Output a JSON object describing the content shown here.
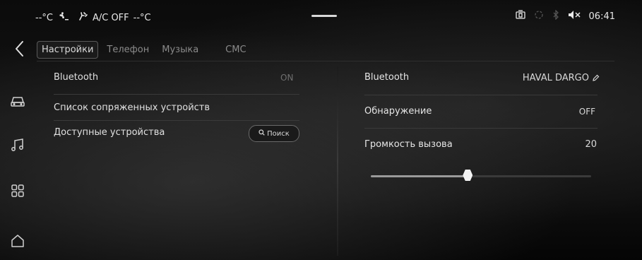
{
  "status_bar": {
    "temp_left": "--°C",
    "fan_icon": "fan-icon",
    "seat_icon": "seat-heat-icon",
    "ac_label": "A/C OFF",
    "temp_right": "--°C",
    "time": "06:41",
    "icons": [
      "phone-projection-icon",
      "sync-icon",
      "bluetooth-icon",
      "mute-icon"
    ]
  },
  "tabs": [
    {
      "label": "Настройки",
      "active": true
    },
    {
      "label": "Телефон",
      "active": false
    },
    {
      "label": "Музыка",
      "active": false
    },
    {
      "label": "СМС",
      "active": false
    }
  ],
  "side_nav": [
    "car-icon",
    "music-icon",
    "apps-icon",
    "home-icon"
  ],
  "left_panel": {
    "bluetooth_label": "Bluetooth",
    "bluetooth_value": "ON",
    "paired_label": "Список сопряженных устройств",
    "available_label": "Доступные устройства",
    "search_label": "Поиск"
  },
  "right_panel": {
    "bluetooth_label": "Bluetooth",
    "device_name": "HAVAL DARGO",
    "discovery_label": "Обнаружение",
    "discovery_value": "OFF",
    "volume_label": "Громкость вызова",
    "volume_value": "20",
    "volume_slider_fraction": 0.44
  },
  "colors": {
    "background": "#0d0d0d",
    "text": "#e6e6e6",
    "muted": "#6f6f6f",
    "accent": "#f2f2f2"
  }
}
